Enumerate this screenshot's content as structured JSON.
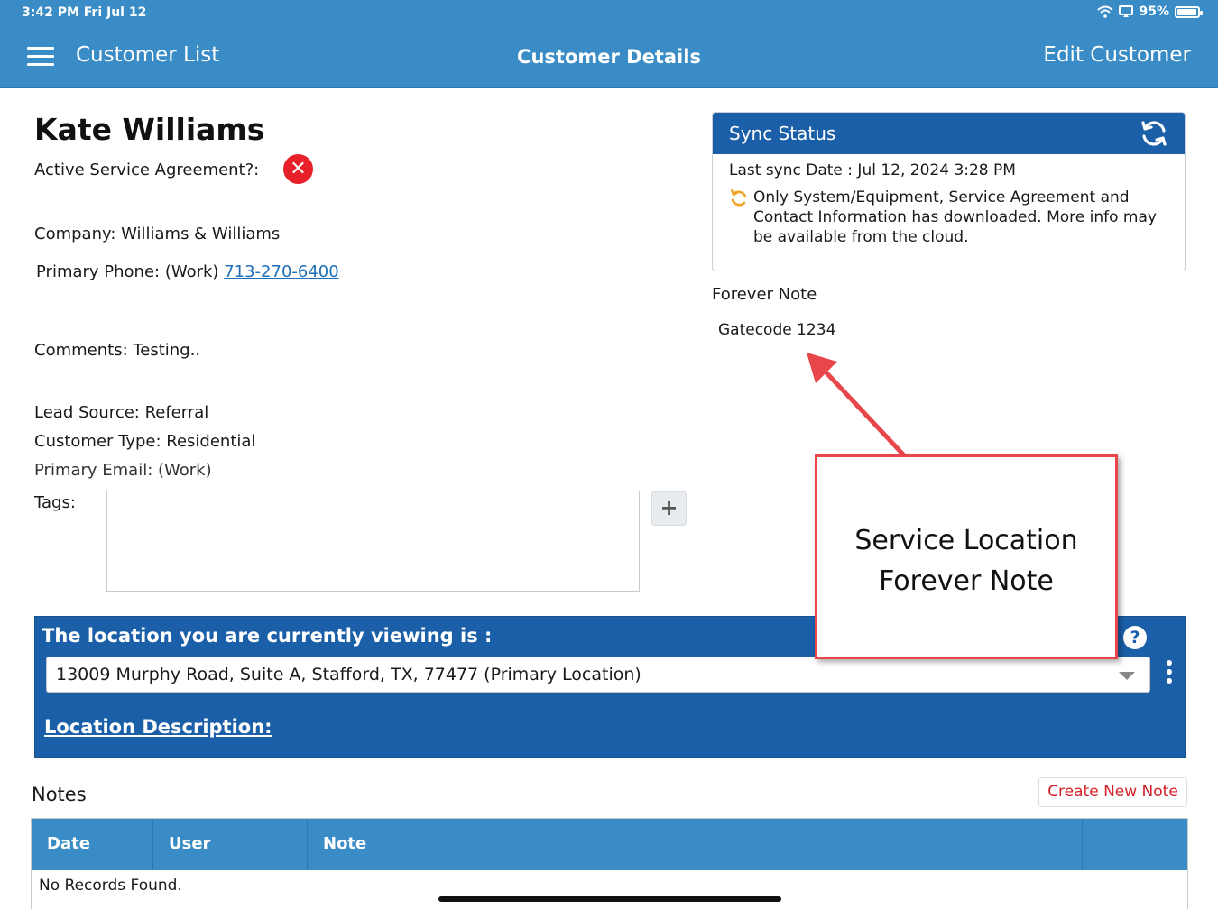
{
  "status_bar": {
    "time": "3:42 PM   Fri Jul 12",
    "battery": "95%",
    "battery_level": 0.95
  },
  "nav": {
    "back_label": "Customer List",
    "title": "Customer Details",
    "edit_label": "Edit Customer"
  },
  "customer": {
    "name": "Kate Williams",
    "agreement_label": "Active Service Agreement?:",
    "agreement_icon": "close-circle-icon",
    "company": "Company: Williams & Williams",
    "phone_label": "Primary Phone: (Work)",
    "phone": "713-270-6400",
    "comments": "Comments: Testing..",
    "lead_source": "Lead Source: Referral",
    "customer_type": "Customer Type: Residential",
    "email": "Primary Email: (Work)",
    "tags_label": "Tags:",
    "tags_add": "+"
  },
  "sync": {
    "title": "Sync Status",
    "last_sync": "Last sync Date : Jul 12, 2024 3:28 PM",
    "message": "Only System/Equipment, Service Agreement and Contact Information has downloaded. More info may be available from the cloud."
  },
  "forever_note": {
    "label": "Forever Note",
    "text": "Gatecode 1234"
  },
  "location": {
    "heading": "The location you are currently viewing is :",
    "help": "?",
    "selected": "13009 Murphy Road, Suite A, Stafford, TX, 77477 (Primary Location)",
    "description_link": "Location Description:"
  },
  "notes": {
    "title": "Notes",
    "create_label": "Create New Note",
    "columns": [
      "Date",
      "User",
      "Note"
    ],
    "empty": "No Records Found."
  },
  "annotation": {
    "line1": "Service Location",
    "line2": "Forever Note"
  }
}
